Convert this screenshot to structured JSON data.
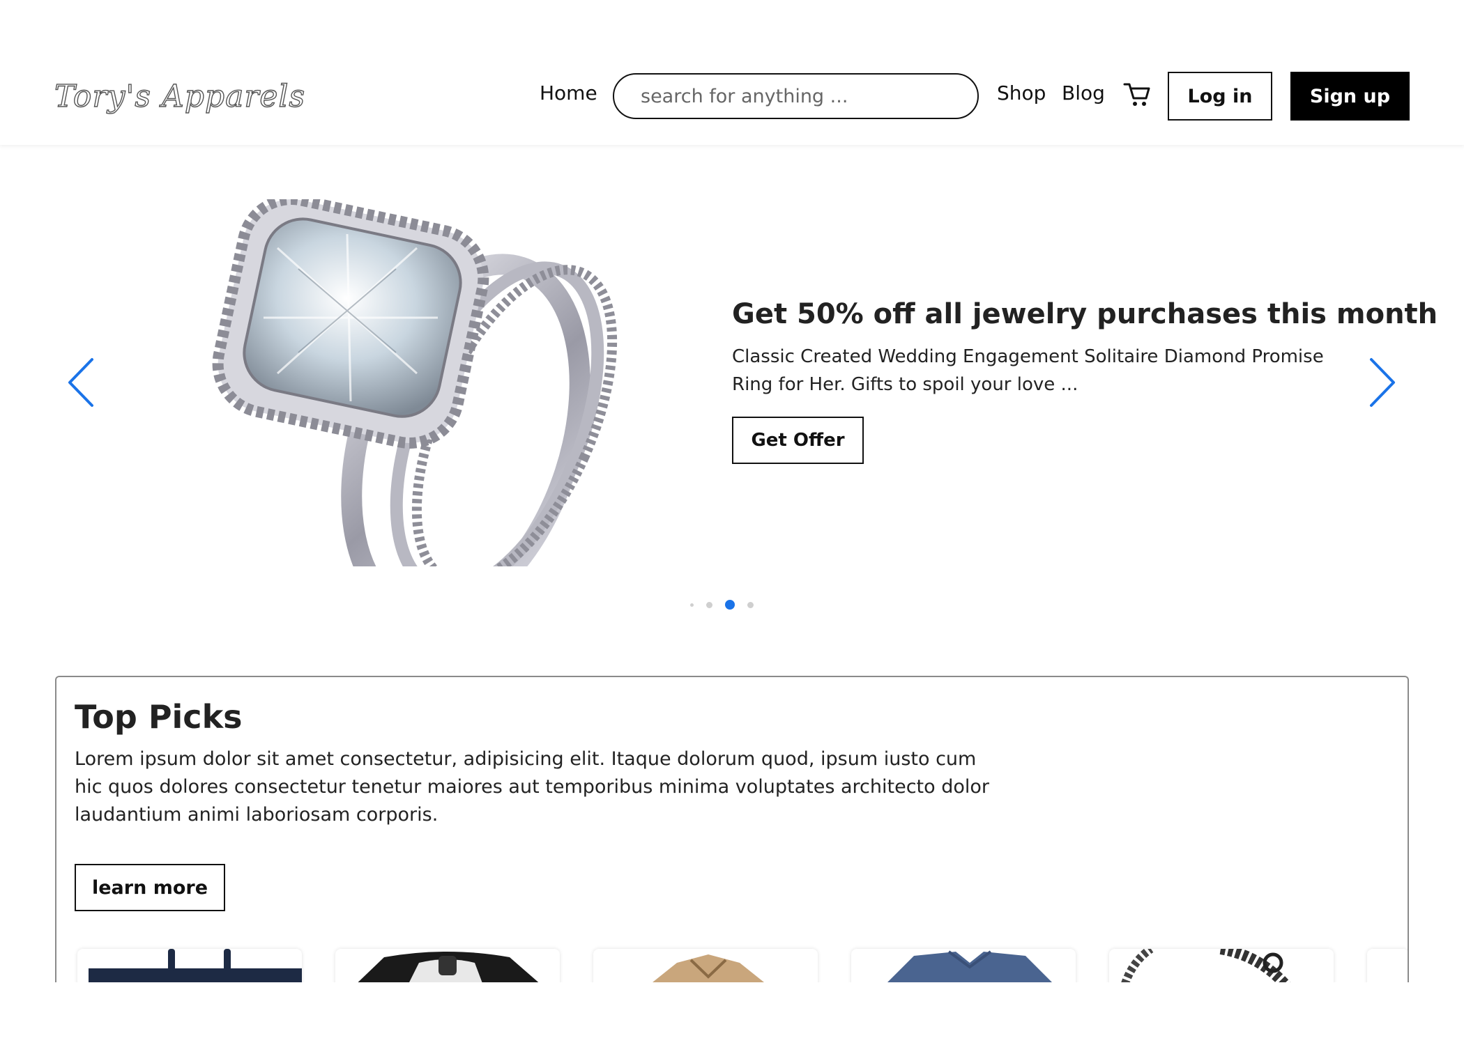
{
  "header": {
    "logo": "Tory's Apparels",
    "nav": {
      "home": "Home",
      "shop": "Shop",
      "blog": "Blog"
    },
    "search_placeholder": "search for anything ...",
    "login_label": "Log in",
    "signup_label": "Sign up",
    "cart_icon": "cart-icon"
  },
  "carousel": {
    "title": "Get 50% off all jewelry purchases this month",
    "description": "Classic Created Wedding Engagement Solitaire Diamond Promise Ring for Her. Gifts to spoil your love ...",
    "button_label": "Get Offer",
    "slide_count": 4,
    "active_slide": 3,
    "colors": {
      "active_dot": "#1a73e8",
      "arrows": "#1a73e8"
    }
  },
  "top_picks": {
    "title": "Top Picks",
    "text": "Lorem ipsum dolor sit amet consectetur, adipisicing elit. Itaque dolorum quod, ipsum iusto cum hic quos dolores consectetur tenetur maiores aut temporibus minima voluptates architecto dolor laudantium animi laboriosam corporis.",
    "button_label": "learn more",
    "products": [
      {
        "icon": "navy-tote-bag-image"
      },
      {
        "icon": "raglan-shirt-image"
      },
      {
        "icon": "tan-jacket-image"
      },
      {
        "icon": "blue-tshirt-image"
      },
      {
        "icon": "chain-bracelet-image"
      }
    ]
  }
}
